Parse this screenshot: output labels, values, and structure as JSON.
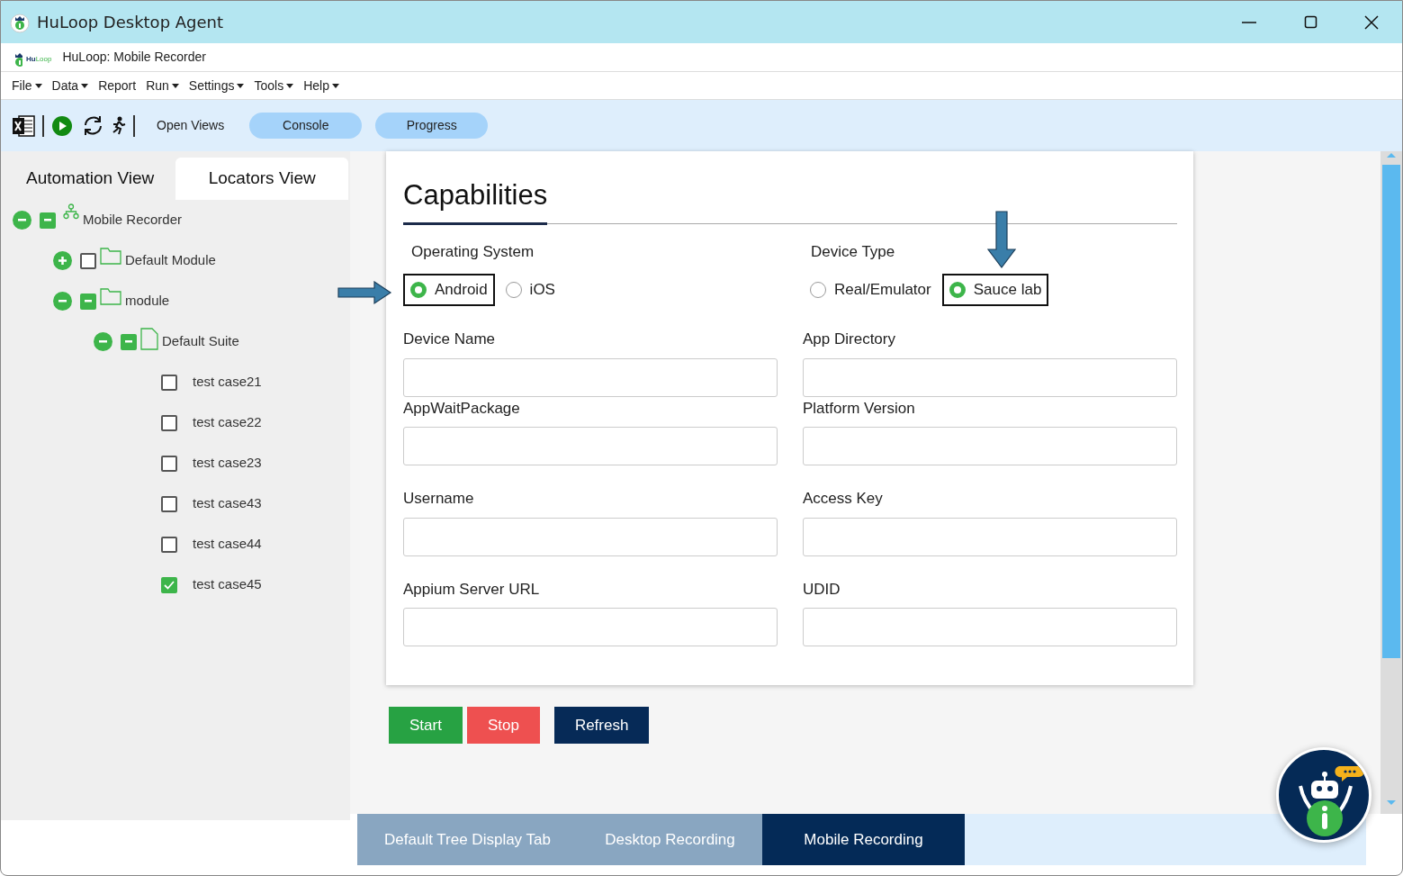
{
  "window": {
    "title": "HuLoop Desktop Agent"
  },
  "app_header": {
    "logo_dark": "Hu",
    "logo_light": "Loop",
    "title": "HuLoop: Mobile Recorder"
  },
  "menu": [
    {
      "label": "File",
      "dropdown": true
    },
    {
      "label": "Data",
      "dropdown": true
    },
    {
      "label": "Report",
      "dropdown": false
    },
    {
      "label": "Run",
      "dropdown": true
    },
    {
      "label": "Settings",
      "dropdown": true
    },
    {
      "label": "Tools",
      "dropdown": true
    },
    {
      "label": "Help",
      "dropdown": true
    }
  ],
  "toolbar": {
    "open_views": "Open Views",
    "buttons": [
      "Console",
      "Progress"
    ]
  },
  "view_tabs": [
    {
      "label": "Automation View",
      "selected": false
    },
    {
      "label": "Locators View",
      "selected": true
    }
  ],
  "tree": [
    {
      "label": "Mobile Recorder",
      "kind": "project",
      "expanded": true,
      "checked": false,
      "indeterminate": true,
      "children": [
        {
          "label": "Default Module",
          "kind": "module",
          "expanded": false,
          "checked": false,
          "indeterminate": false
        },
        {
          "label": "module",
          "kind": "module",
          "expanded": true,
          "checked": false,
          "indeterminate": true,
          "children": [
            {
              "label": "Default Suite",
              "kind": "suite",
              "expanded": true,
              "checked": false,
              "indeterminate": true,
              "children": [
                {
                  "label": "test case21",
                  "kind": "case",
                  "checked": false,
                  "indeterminate": false
                },
                {
                  "label": "test case22",
                  "kind": "case",
                  "checked": false,
                  "indeterminate": false
                },
                {
                  "label": "test case23",
                  "kind": "case",
                  "checked": false,
                  "indeterminate": false
                },
                {
                  "label": "test case43",
                  "kind": "case",
                  "checked": false,
                  "indeterminate": false
                },
                {
                  "label": "test case44",
                  "kind": "case",
                  "checked": false,
                  "indeterminate": false
                },
                {
                  "label": "test case45",
                  "kind": "case",
                  "checked": true,
                  "indeterminate": false
                }
              ]
            }
          ]
        }
      ]
    }
  ],
  "capabilities": {
    "title": "Capabilities",
    "radio_groups": [
      {
        "label": "Operating System",
        "options": [
          {
            "label": "Android",
            "selected": true,
            "highlighted": true,
            "arrow_from_left": true,
            "arrow_from_above": false
          },
          {
            "label": "iOS",
            "selected": false,
            "highlighted": false,
            "arrow_from_left": false,
            "arrow_from_above": false
          }
        ]
      },
      {
        "label": "Device Type",
        "options": [
          {
            "label": "Real/Emulator",
            "selected": false,
            "highlighted": false,
            "arrow_from_left": false,
            "arrow_from_above": false
          },
          {
            "label": "Sauce lab",
            "selected": true,
            "highlighted": true,
            "arrow_from_left": false,
            "arrow_from_above": true
          }
        ]
      }
    ],
    "fields": [
      {
        "label": "Device Name"
      },
      {
        "label": "App Directory"
      },
      {
        "label": "AppWaitPackage"
      },
      {
        "label": "Platform Version"
      },
      {
        "label": "Username"
      },
      {
        "label": "Access Key"
      },
      {
        "label": "Appium Server URL"
      },
      {
        "label": "UDID"
      }
    ]
  },
  "actions": [
    {
      "label": "Start",
      "kind": "success"
    },
    {
      "label": "Stop",
      "kind": "danger"
    },
    {
      "label": "Refresh",
      "kind": "primary"
    }
  ],
  "bottom_tabs": [
    {
      "label": "Default Tree Display Tab",
      "selected": false
    },
    {
      "label": "Desktop Recording",
      "selected": false
    },
    {
      "label": "Mobile Recording",
      "selected": true
    }
  ]
}
